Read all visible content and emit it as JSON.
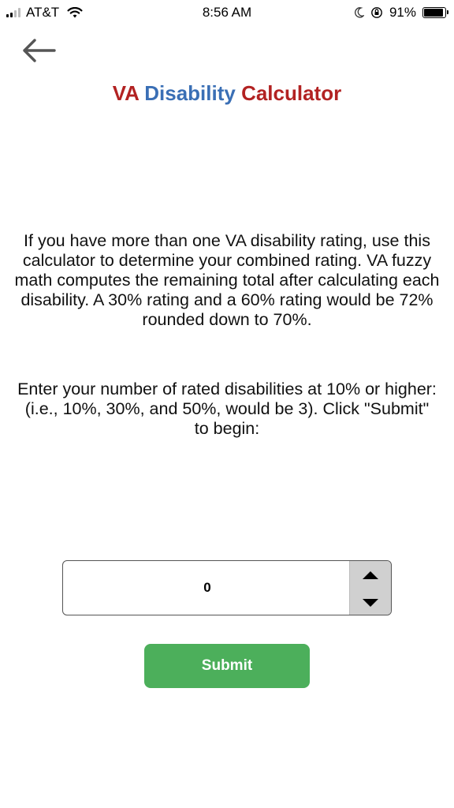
{
  "status_bar": {
    "carrier": "AT&T",
    "time": "8:56 AM",
    "battery_percent": "91%",
    "battery_level": 0.91,
    "icons": [
      "signal-icon",
      "wifi-icon",
      "moon-icon",
      "orientation-lock-icon",
      "battery-icon"
    ]
  },
  "nav": {
    "back_icon": "back-arrow-icon"
  },
  "title": {
    "part1": "VA",
    "part2": "Disability",
    "part3": "Calculator",
    "colors": {
      "red": "#b22222",
      "blue": "#3a6fb5"
    }
  },
  "intro": {
    "text": "If you have more than one VA disability rating, use this calculator to determine your combined rating. VA fuzzy math computes the remaining total after calculating each disability. A 30% rating and a 60% rating would be 72% rounded down to 70%."
  },
  "instructions": {
    "line1": "Enter your number of rated disabilities at 10% or higher:",
    "line2": "(i.e., 10%, 30%, and 50%, would be 3). Click \"Submit\" to begin:"
  },
  "input": {
    "value": "0",
    "stepper_icons": [
      "caret-up-icon",
      "caret-down-icon"
    ]
  },
  "submit": {
    "label": "Submit",
    "color": "#4caf5b"
  }
}
